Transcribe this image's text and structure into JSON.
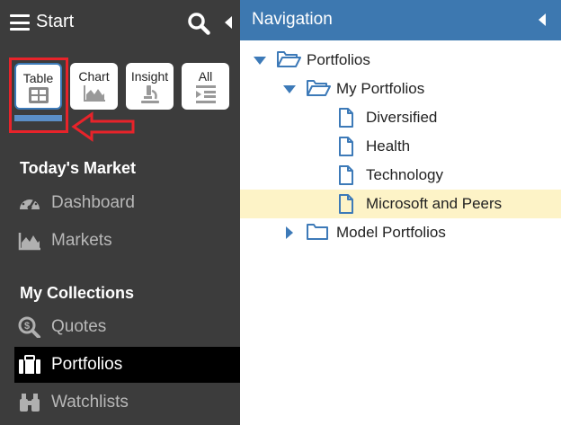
{
  "sidebar": {
    "title": "Start",
    "view_buttons": [
      {
        "label": "Table",
        "icon": "table-icon",
        "active": true
      },
      {
        "label": "Chart",
        "icon": "area-chart-icon",
        "active": false
      },
      {
        "label": "Insight",
        "icon": "microscope-icon",
        "active": false
      },
      {
        "label": "All",
        "icon": "list-indent-icon",
        "active": false
      }
    ],
    "sections": [
      {
        "title": "Today's Market",
        "items": [
          {
            "label": "Dashboard",
            "icon": "gauge-icon"
          },
          {
            "label": "Markets",
            "icon": "area-chart-icon"
          }
        ]
      },
      {
        "title": "My Collections",
        "items": [
          {
            "label": "Quotes",
            "icon": "dollar-magnifier-icon"
          },
          {
            "label": "Portfolios",
            "icon": "briefcase-icon",
            "selected": true
          },
          {
            "label": "Watchlists",
            "icon": "binoculars-icon"
          }
        ]
      }
    ]
  },
  "navigation": {
    "title": "Navigation",
    "tree": [
      {
        "label": "Portfolios",
        "type": "folder",
        "expanded": true,
        "level": 0
      },
      {
        "label": "My Portfolios",
        "type": "folder",
        "expanded": true,
        "level": 1
      },
      {
        "label": "Diversified",
        "type": "file",
        "level": 2
      },
      {
        "label": "Health",
        "type": "file",
        "level": 2
      },
      {
        "label": "Technology",
        "type": "file",
        "level": 2
      },
      {
        "label": "Microsoft and Peers",
        "type": "file",
        "level": 2,
        "highlighted": true
      },
      {
        "label": "Model Portfolios",
        "type": "folder",
        "expanded": false,
        "level": 1
      }
    ]
  },
  "colors": {
    "sidebar_bg": "#3c3c3c",
    "header_blue": "#3d78b0",
    "tree_blue": "#3d7ab8",
    "highlight_row": "#fdf3c7",
    "annotation_red": "#e8232a"
  }
}
